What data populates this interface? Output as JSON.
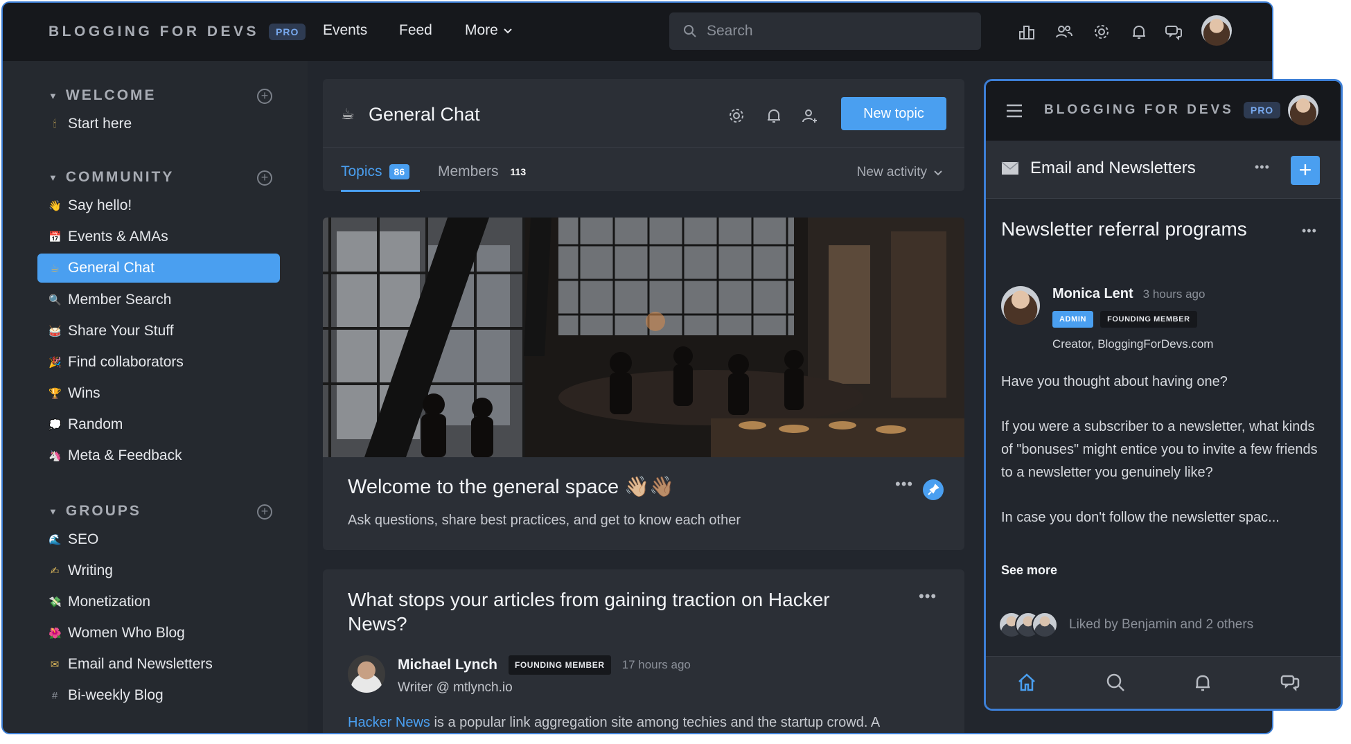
{
  "topbar": {
    "brand": "BLOGGING FOR DEVS",
    "pro_badge": "PRO",
    "nav": [
      "Events",
      "Feed",
      "More"
    ],
    "search_placeholder": "Search",
    "icons": [
      "leaderboard-icon",
      "members-icon",
      "settings-icon",
      "notifications-icon",
      "messages-icon",
      "user-avatar"
    ]
  },
  "sidebar": {
    "sections": [
      {
        "title": "WELCOME",
        "items": [
          {
            "emoji": "🕯",
            "label": "Start here"
          }
        ]
      },
      {
        "title": "COMMUNITY",
        "items": [
          {
            "emoji": "👋",
            "label": "Say hello!"
          },
          {
            "emoji": "📅",
            "label": "Events & AMAs"
          },
          {
            "emoji": "☕",
            "label": "General Chat",
            "active": true
          },
          {
            "emoji": "🔍",
            "label": "Member Search"
          },
          {
            "emoji": "🥁",
            "label": "Share Your Stuff"
          },
          {
            "emoji": "🎉",
            "label": "Find collaborators"
          },
          {
            "emoji": "🏆",
            "label": "Wins"
          },
          {
            "emoji": "💭",
            "label": "Random"
          },
          {
            "emoji": "🦄",
            "label": "Meta & Feedback"
          }
        ]
      },
      {
        "title": "GROUPS",
        "items": [
          {
            "emoji": "🌊",
            "label": "SEO"
          },
          {
            "emoji": "✍",
            "label": "Writing"
          },
          {
            "emoji": "💸",
            "label": "Monetization"
          },
          {
            "emoji": "🌺",
            "label": "Women Who Blog"
          },
          {
            "emoji": "✉",
            "label": "Email and Newsletters"
          },
          {
            "emoji": "#",
            "label": "Bi-weekly Blog"
          }
        ]
      }
    ]
  },
  "channel": {
    "title": "General Chat",
    "new_topic": "New topic",
    "tabs": [
      {
        "label": "Topics",
        "count": "86"
      },
      {
        "label": "Members",
        "count": "113"
      }
    ],
    "sort": "New activity"
  },
  "posts": [
    {
      "title": "Welcome to the general space 👋🏼👋🏽",
      "subtitle": "Ask questions, share best practices, and get to know each other"
    },
    {
      "title": "What stops your articles from gaining traction on Hacker News?",
      "author": "Michael Lynch",
      "badge": "FOUNDING MEMBER",
      "time": "17 hours ago",
      "byline": "Writer @ mtlynch.io",
      "body_link": "Hacker News",
      "body_rest": " is a popular link aggregation site among techies and the startup crowd. A"
    }
  ],
  "mobile": {
    "brand": "BLOGGING FOR DEVS",
    "pro_badge": "PRO",
    "channel": "Email and Newsletters",
    "post_title": "Newsletter referral programs",
    "author": "Monica Lent",
    "time": "3 hours ago",
    "badges": [
      "ADMIN",
      "FOUNDING MEMBER"
    ],
    "byline": "Creator, BloggingForDevs.com",
    "paragraphs": [
      "Have you thought about having one?",
      "If you were a subscriber to a newsletter, what kinds of \"bonuses\" might entice you to invite a few friends to a newsletter you genuinely like?",
      "In case you don't follow the newsletter spac..."
    ],
    "see_more": "See more",
    "likes": "Liked by Benjamin and 2 others"
  },
  "colors": {
    "accent": "#4a9ff0",
    "topbar": "#16181c",
    "surface": "#22262d",
    "card": "#2b2f36"
  }
}
